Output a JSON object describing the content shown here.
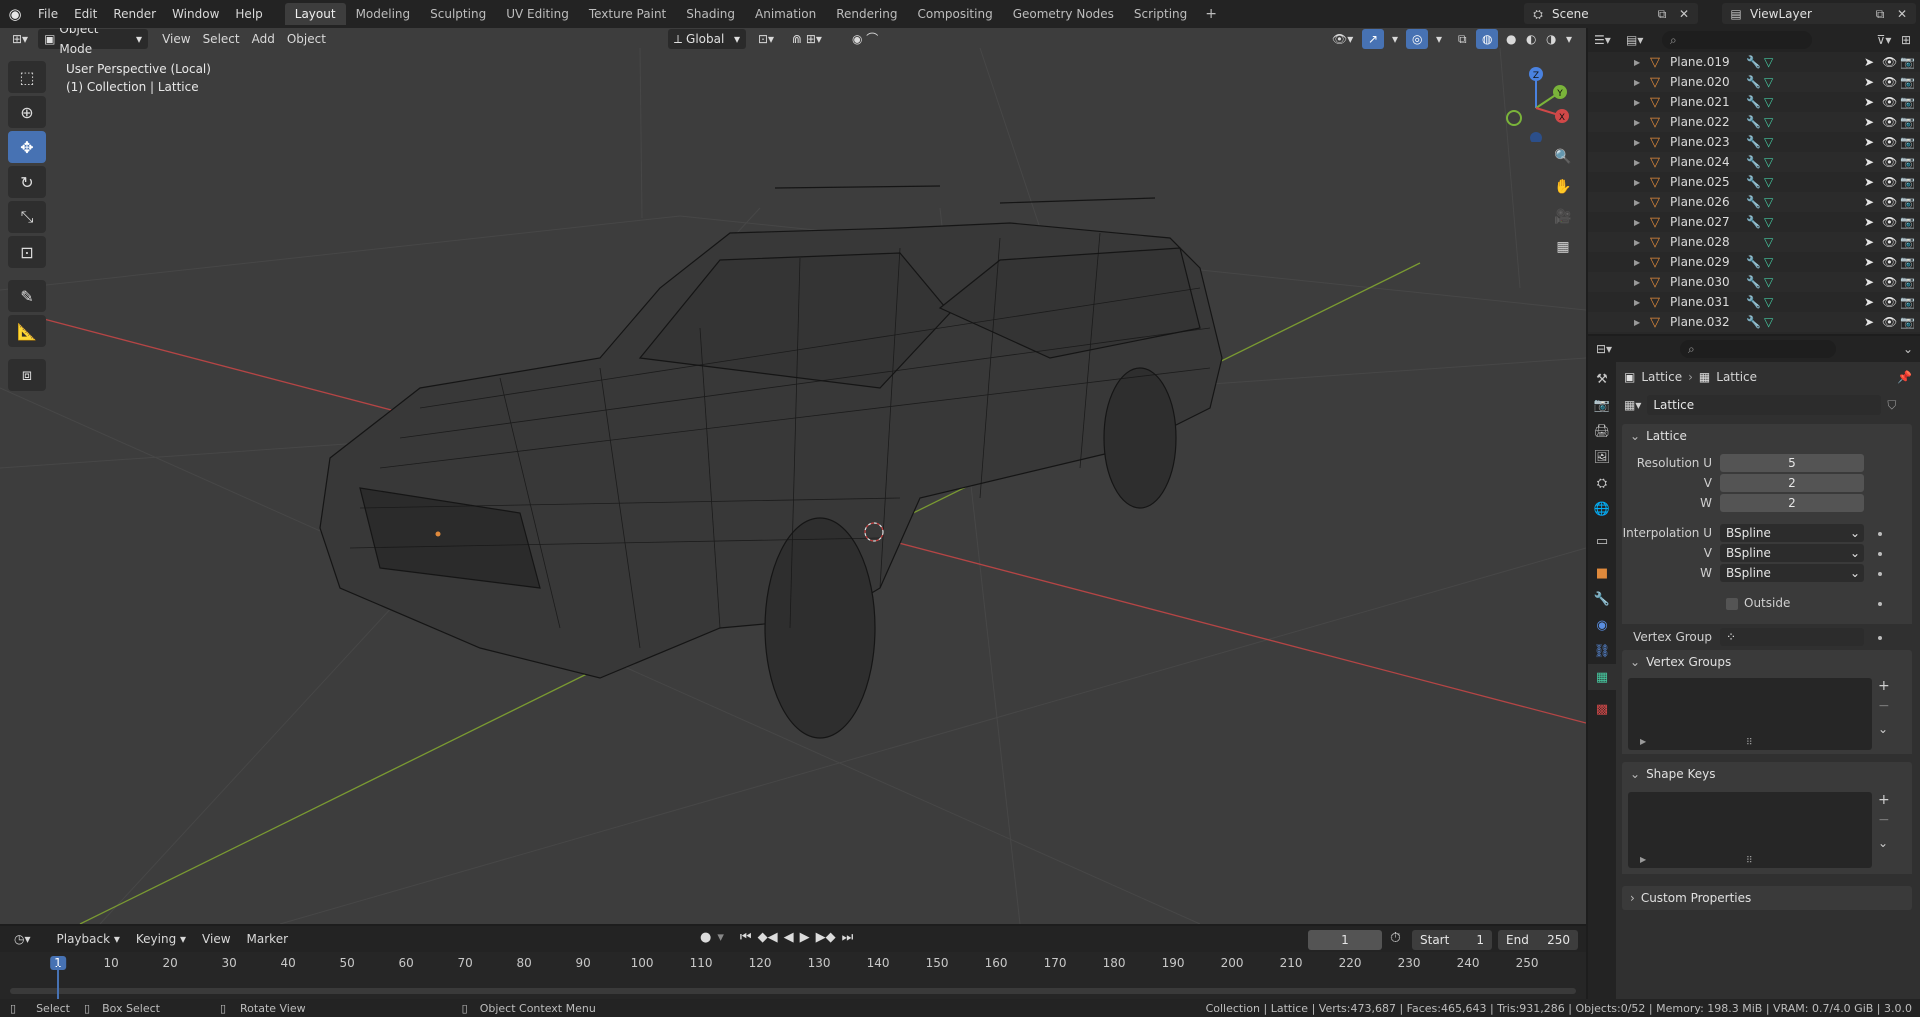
{
  "topbar": {
    "menus": [
      "File",
      "Edit",
      "Render",
      "Window",
      "Help"
    ],
    "workspaces": [
      "Layout",
      "Modeling",
      "Sculpting",
      "UV Editing",
      "Texture Paint",
      "Shading",
      "Animation",
      "Rendering",
      "Compositing",
      "Geometry Nodes",
      "Scripting"
    ],
    "active_workspace": "Layout",
    "scene_name": "Scene",
    "view_layer": "ViewLayer"
  },
  "viewport": {
    "header": {
      "mode": "Object Mode",
      "menus": [
        "View",
        "Select",
        "Add",
        "Object"
      ],
      "orientation": "Global"
    },
    "overlay_line1": "User Perspective (Local)",
    "overlay_line2": "(1) Collection | Lattice",
    "gizmo": {
      "z": "Z",
      "y": "Y",
      "x": "X"
    },
    "tools": [
      "select-box",
      "cursor",
      "move",
      "rotate",
      "scale",
      "transform",
      "annotate",
      "measure",
      "add-cube"
    ]
  },
  "timeline": {
    "menus": [
      "Playback",
      "Keying",
      "View",
      "Marker"
    ],
    "current_frame": "1",
    "start_label": "Start",
    "start": "1",
    "end_label": "End",
    "end": "250",
    "ticks": [
      "1",
      "10",
      "20",
      "30",
      "40",
      "50",
      "60",
      "70",
      "80",
      "90",
      "100",
      "110",
      "120",
      "130",
      "140",
      "150",
      "160",
      "170",
      "180",
      "190",
      "200",
      "210",
      "220",
      "230",
      "240",
      "250"
    ]
  },
  "outliner": {
    "items": [
      {
        "name": "Plane.019",
        "mod": true
      },
      {
        "name": "Plane.020",
        "mod": true
      },
      {
        "name": "Plane.021",
        "mod": true
      },
      {
        "name": "Plane.022",
        "mod": true
      },
      {
        "name": "Plane.023",
        "mod": true
      },
      {
        "name": "Plane.024",
        "mod": true
      },
      {
        "name": "Plane.025",
        "mod": true
      },
      {
        "name": "Plane.026",
        "mod": true
      },
      {
        "name": "Plane.027",
        "mod": true
      },
      {
        "name": "Plane.028",
        "mod": false
      },
      {
        "name": "Plane.029",
        "mod": true
      },
      {
        "name": "Plane.030",
        "mod": true
      },
      {
        "name": "Plane.031",
        "mod": true
      },
      {
        "name": "Plane.032",
        "mod": true
      }
    ]
  },
  "properties": {
    "breadcrumb_object": "Lattice",
    "breadcrumb_data": "Lattice",
    "datablock_name": "Lattice",
    "panel_lattice": "Lattice",
    "resolution_u_label": "Resolution U",
    "resolution_u": "5",
    "v_label": "V",
    "resolution_v": "2",
    "w_label": "W",
    "resolution_w": "2",
    "interp_u_label": "Interpolation U",
    "interp_u": "BSpline",
    "interp_v_label": "V",
    "interp_v": "BSpline",
    "interp_w_label": "W",
    "interp_w": "BSpline",
    "outside_label": "Outside",
    "vertex_group_label": "Vertex Group",
    "panel_vertex_groups": "Vertex Groups",
    "panel_shape_keys": "Shape Keys",
    "panel_custom_props": "Custom Properties"
  },
  "statusbar": {
    "select": "Select",
    "box_select": "Box Select",
    "rotate_view": "Rotate View",
    "context_menu": "Object Context Menu",
    "stats": "Collection | Lattice | Verts:473,687 | Faces:465,643 | Tris:931,286 | Objects:0/52 | Memory: 198.3 MiB | VRAM: 0.7/4.0 GiB | 3.0.0"
  },
  "colors": {
    "accent": "#4772b3",
    "x_axis": "#b54545",
    "y_axis": "#7a9a32",
    "object_orange": "#e08a3c",
    "mesh_green": "#46c9a0"
  }
}
